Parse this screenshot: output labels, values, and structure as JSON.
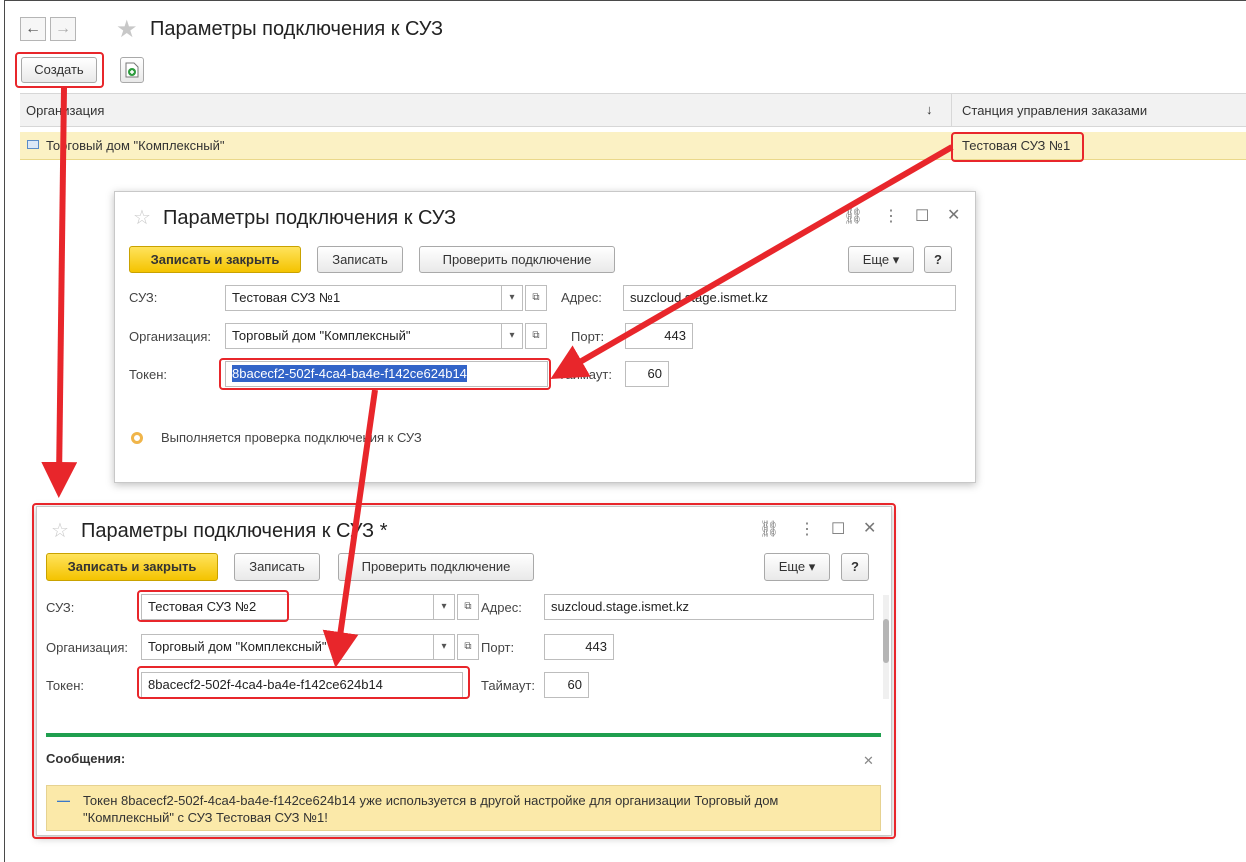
{
  "main": {
    "title": "Параметры подключения к СУЗ",
    "create_button": "Создать",
    "nav_back": "←",
    "nav_forward": "→",
    "columns": [
      "Организация",
      "Станция управления заказами"
    ],
    "sort_indicator": "↓",
    "rows": [
      {
        "org": "Торговый дом \"Комплексный\"",
        "station": "Тестовая СУЗ №1"
      }
    ]
  },
  "dialog1": {
    "title": "Параметры подключения к СУЗ",
    "save_close": "Записать и закрыть",
    "save": "Записать",
    "check": "Проверить подключение",
    "more": "Еще",
    "help": "?",
    "suz_label": "СУЗ:",
    "suz_value": "Тестовая СУЗ №1",
    "org_label": "Организация:",
    "org_value": "Торговый дом \"Комплексный\"",
    "token_label": "Токен:",
    "token_value": "8bacecf2-502f-4ca4-ba4e-f142ce624b14",
    "address_label": "Адрес:",
    "address_value": "suzcloud.stage.ismet.kz",
    "port_label": "Порт:",
    "port_value": "443",
    "timeout_label": "Таймаут:",
    "timeout_value": "60",
    "status": "Выполняется проверка подключения к СУЗ"
  },
  "dialog2": {
    "title": "Параметры подключения к СУЗ *",
    "save_close": "Записать и закрыть",
    "save": "Записать",
    "check": "Проверить подключение",
    "more": "Еще",
    "help": "?",
    "suz_label": "СУЗ:",
    "suz_value": "Тестовая СУЗ №2",
    "org_label": "Организация:",
    "org_value": "Торговый дом \"Комплексный\"",
    "token_label": "Токен:",
    "token_value": "8bacecf2-502f-4ca4-ba4e-f142ce624b14",
    "address_label": "Адрес:",
    "address_value": "suzcloud.stage.ismet.kz",
    "port_label": "Порт:",
    "port_value": "443",
    "timeout_label": "Таймаут:",
    "timeout_value": "60",
    "messages_title": "Сообщения:",
    "message_text": "Токен 8bacecf2-502f-4ca4-ba4e-f142ce624b14 уже используется в другой настройке для организации Торговый дом \"Комплексный\" с СУЗ Тестовая СУЗ №1!"
  },
  "colors": {
    "accent_red": "#e8262b",
    "button_yellow": "#f4c300",
    "row_highlight": "#fbf1c4",
    "message_bg": "#fbe9a9",
    "divider_green": "#1f9f4f"
  }
}
